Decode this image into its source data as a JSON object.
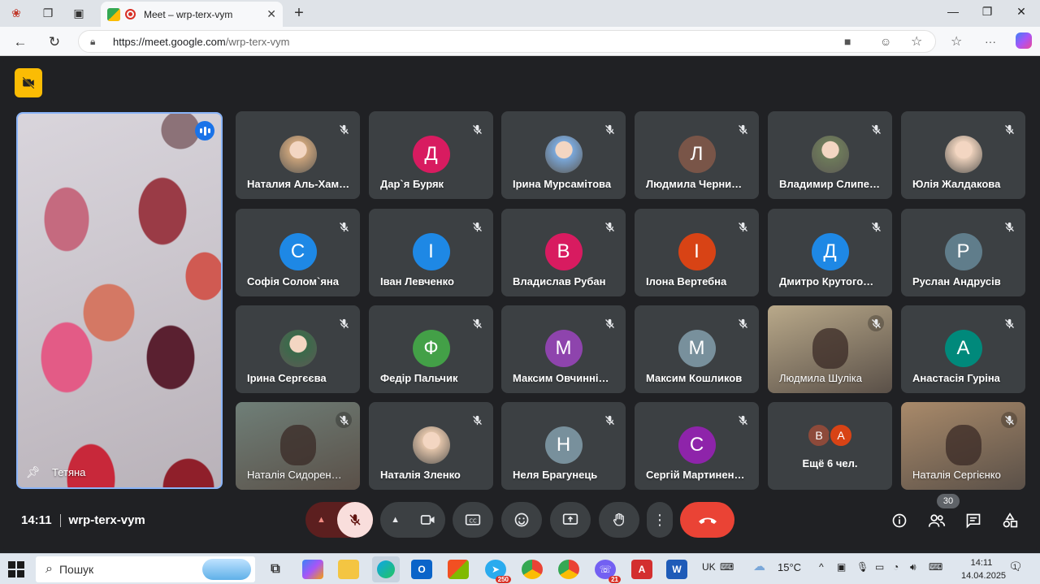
{
  "browser": {
    "tab_title": "Meet – wrp-terx-vym",
    "new_tab": "+",
    "url_host": "https://meet.google.com",
    "url_path": "/wrp-terx-vym"
  },
  "meet": {
    "featured": {
      "name": "Тетяна"
    },
    "tiles": [
      {
        "name": "Наталия Аль-Хам…",
        "avatar": "",
        "color": "#c9a27a",
        "photo": true
      },
      {
        "name": "Дар`я Буряк",
        "avatar": "Д",
        "color": "#d81b60"
      },
      {
        "name": "Ірина Мурсамітова",
        "avatar": "",
        "color": "#7aa7d9",
        "photo": true
      },
      {
        "name": "Людмила Черни…",
        "avatar": "Л",
        "color": "#795548"
      },
      {
        "name": "Владимир Слипе…",
        "avatar": "",
        "color": "#6d7a5a",
        "photo": true
      },
      {
        "name": "Юлія Жалдакова",
        "avatar": "",
        "color": "#e8cdb8",
        "photo": true
      },
      {
        "name": "Софія Солом`яна",
        "avatar": "С",
        "color": "#1e88e5"
      },
      {
        "name": "Іван Левченко",
        "avatar": "І",
        "color": "#1e88e5"
      },
      {
        "name": "Владислав Рубан",
        "avatar": "В",
        "color": "#d81b60"
      },
      {
        "name": "Ілона Вертебна",
        "avatar": "І",
        "color": "#d84315"
      },
      {
        "name": "Дмитро Крутого…",
        "avatar": "Д",
        "color": "#1e88e5"
      },
      {
        "name": "Руслан Андрусів",
        "avatar": "Р",
        "color": "#607d8b"
      },
      {
        "name": "Ірина Сергєєва",
        "avatar": "",
        "color": "#3a6a4a",
        "photo": true
      },
      {
        "name": "Федір Пальчик",
        "avatar": "Ф",
        "color": "#43a047"
      },
      {
        "name": "Максим Овчинні…",
        "avatar": "М",
        "color": "#8e44ad"
      },
      {
        "name": "Максим Кошликов",
        "avatar": "М",
        "color": "#78909c"
      },
      {
        "name": "Людмила Шуліка",
        "avatar": "",
        "color": "#b9a98a",
        "video": true
      },
      {
        "name": "Анастасія Гуріна",
        "avatar": "А",
        "color": "#00897b"
      },
      {
        "name": "Наталія Сидорен…",
        "avatar": "",
        "color": "#6f7f78",
        "video": true
      },
      {
        "name": "Наталія Зленко",
        "avatar": "",
        "color": "#e0c2a8",
        "photo": true
      },
      {
        "name": "Неля Брагунець",
        "avatar": "Н",
        "color": "#78909c"
      },
      {
        "name": "Сергій Мартинен…",
        "avatar": "С",
        "color": "#8e24aa"
      },
      {
        "name": "",
        "avatar": "",
        "color": "#3c4043",
        "more": true
      },
      {
        "name": "Наталія Сергієнко",
        "avatar": "",
        "color": "#a98a6a",
        "video": true
      }
    ],
    "more": {
      "label": "Ещё 6 чел.",
      "a1": "В",
      "a2": "А"
    },
    "time": "14:11",
    "code": "wrp-terx-vym",
    "people_count": "30"
  },
  "taskbar": {
    "search_placeholder": "Пошук",
    "lang": "UK",
    "temp": "15°C",
    "time": "14:11",
    "date": "14.04.2025",
    "telegram_badge": "250",
    "viber_badge": "21",
    "notif_count": "1"
  }
}
